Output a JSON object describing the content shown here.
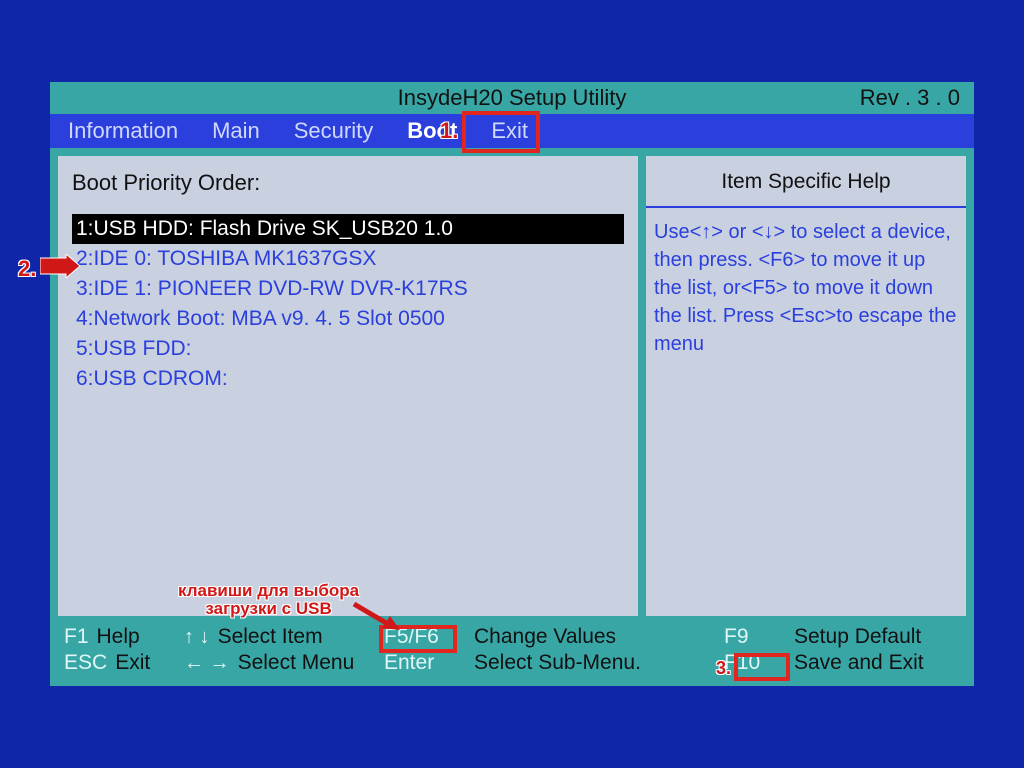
{
  "header": {
    "title": "InsydeH20  Setup  Utility",
    "revision": "Rev . 3 . 0"
  },
  "tabs": {
    "items": [
      "Information",
      "Main",
      "Security",
      "Boot",
      "Exit"
    ],
    "active_index": 3
  },
  "left_panel": {
    "heading": "Boot Priority Order:",
    "items": [
      "1:USB HDD:  Flash Drive  SK_USB20  1.0",
      "2:IDE 0: TOSHIBA MK1637GSX",
      "3:IDE 1: PIONEER DVD-RW  DVR-K17RS",
      "4:Network Boot:  MBA  v9. 4. 5  Slot  0500",
      "5:USB FDD:",
      "6:USB CDROM:"
    ],
    "selected_index": 0
  },
  "right_panel": {
    "title": "Item Specific Help",
    "body": "Use<↑> or <↓> to select a device,  then press. <F6> to move it up the list, or<F5> to move it down the list. Press <Esc>to escape the menu"
  },
  "footer": {
    "r1": {
      "k1": "F1",
      "l1": "Help",
      "l2": "Select Item",
      "k3": "F5/F6",
      "l3": "Change Values",
      "k4": "F9",
      "l4": "Setup Default"
    },
    "r2": {
      "k1": "ESC",
      "l1": "Exit",
      "l2": "Select Menu",
      "k3": "Enter",
      "l3": "Select  Sub-Menu.",
      "k4": "F10",
      "l4": "Save and Exit"
    }
  },
  "annotations": {
    "n1": "1.",
    "n2": "2.",
    "n3": "3.",
    "usb_note_line1": "клавиши для выбора",
    "usb_note_line2": "загрузки с USB"
  }
}
